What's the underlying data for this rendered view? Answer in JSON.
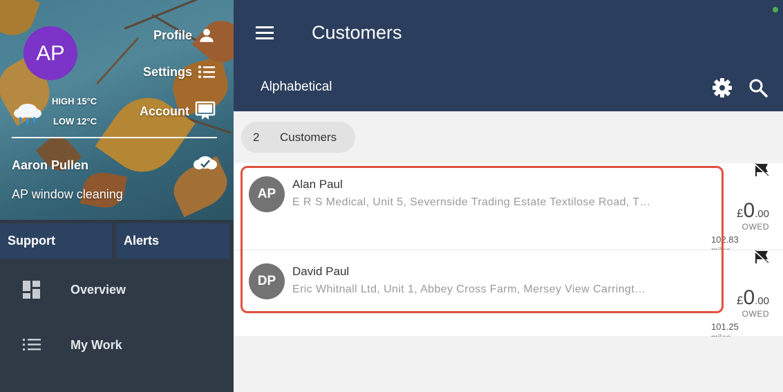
{
  "sidebar": {
    "avatar_initials": "AP",
    "avatar_color": "#7b34c7",
    "menu": [
      {
        "label": "Profile",
        "icon": "person-icon"
      },
      {
        "label": "Settings",
        "icon": "list-icon"
      },
      {
        "label": "Account",
        "icon": "monitor-icon"
      }
    ],
    "weather": {
      "icon": "rain-cloud-icon",
      "high": "HIGH 15°C",
      "low": "LOW 12°C"
    },
    "user_name": "Aaron Pullen",
    "business_name": "AP window cleaning",
    "sync_icon": "cloud-check-icon",
    "tabs": [
      "Support",
      "Alerts"
    ],
    "nav": [
      {
        "label": "Overview",
        "icon": "dashboard-icon"
      },
      {
        "label": "My Work",
        "icon": "list-icon"
      }
    ]
  },
  "appbar": {
    "title": "Customers",
    "menu_icon": "hamburger-icon"
  },
  "subbar": {
    "sort_label": "Alphabetical",
    "icons": [
      "gear-icon",
      "search-icon"
    ]
  },
  "chip": {
    "count": "2",
    "label": "Customers"
  },
  "customers": [
    {
      "initials": "AP",
      "name": "Alan Paul",
      "address": "E R S Medical, Unit 5, Severnside Trading Estate Textilose Road, T…",
      "currency": "£",
      "amount_int": "0",
      "amount_dec": ".00",
      "owed_label": "OWED",
      "distance": "102.83",
      "distance_unit": "miles"
    },
    {
      "initials": "DP",
      "name": "David Paul",
      "address": "Eric Whitnall Ltd, Unit 1, Abbey Cross Farm, Mersey View Carringt…",
      "currency": "£",
      "amount_int": "0",
      "amount_dec": ".00",
      "owed_label": "OWED",
      "distance": "101.25",
      "distance_unit": "miles"
    }
  ],
  "colors": {
    "appbar": "#2c3e5d",
    "sidebar": "#2f3a46",
    "highlight": "#e0513f",
    "status_online": "#4caf50"
  }
}
